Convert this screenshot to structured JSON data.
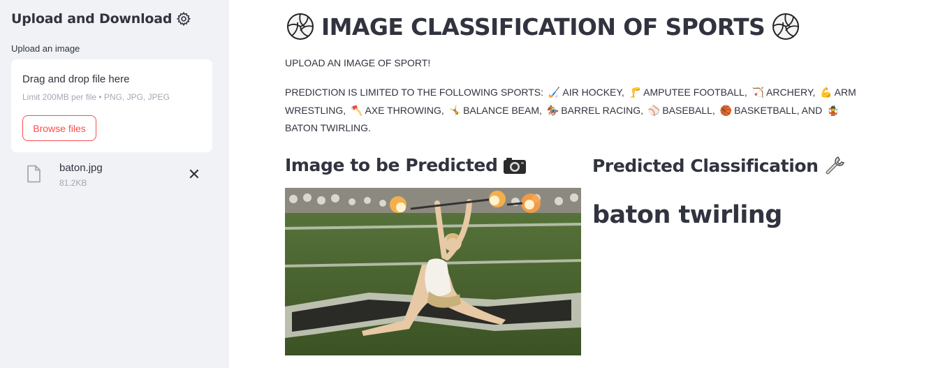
{
  "sidebar": {
    "title": "Upload and Download",
    "title_icon": "gear-icon",
    "upload_label": "Upload an image",
    "dropzone": {
      "title": "Drag and drop file here",
      "limit": "Limit 200MB per file • PNG, JPG, JPEG",
      "browse_label": "Browse files"
    },
    "file": {
      "icon": "file-icon",
      "name": "baton.jpg",
      "size": "81.2KB",
      "remove_icon": "close-icon"
    }
  },
  "main": {
    "title": "IMAGE CLASSIFICATION OF SPORTS",
    "title_icon": "volleyball-icon",
    "subtitle": "UPLOAD AN IMAGE OF SPORT!",
    "sports_intro": "PREDICTION IS LIMITED TO THE FOLLOWING SPORTS:",
    "sports": [
      {
        "label": "AIR HOCKEY,",
        "icon": "hockey-stick-icon",
        "glyph": "🏑"
      },
      {
        "label": "AMPUTEE FOOTBALL,",
        "icon": "leg-icon",
        "glyph": "🦵"
      },
      {
        "label": "ARCHERY,",
        "icon": "bow-and-arrow-icon",
        "glyph": "🏹"
      },
      {
        "label": "ARM WRESTLING,",
        "icon": "flexed-biceps-icon",
        "glyph": "💪"
      },
      {
        "label": "AXE THROWING,",
        "icon": "axe-icon",
        "glyph": "🪓"
      },
      {
        "label": "BALANCE BEAM,",
        "icon": "gymnast-icon",
        "glyph": "🤸"
      },
      {
        "label": "BARREL RACING,",
        "icon": "horse-racing-icon",
        "glyph": "🏇"
      },
      {
        "label": "BASEBALL,",
        "icon": "baseball-icon",
        "glyph": "⚾"
      },
      {
        "label": "BASKETBALL, AND",
        "icon": "basketball-icon",
        "glyph": "🏀"
      },
      {
        "label": "BATON TWIRLING.",
        "icon": "juggling-icon",
        "glyph": "🤹"
      }
    ],
    "left_heading": "Image to be Predicted",
    "left_heading_icon": "camera-icon",
    "right_heading": "Predicted Classification",
    "right_heading_icon": "wrench-icon",
    "prediction": "baton twirling"
  },
  "colors": {
    "sidebar_bg": "#f0f2f6",
    "text": "#31333f",
    "accent": "#ff4b4b",
    "muted": "#a3a8b4"
  }
}
